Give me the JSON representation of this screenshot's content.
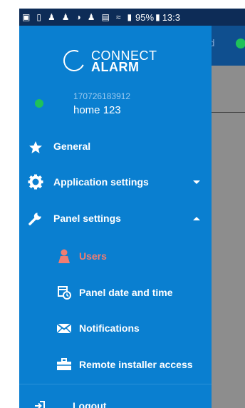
{
  "status_bar": {
    "battery": "95%",
    "time": "13:3"
  },
  "background": {
    "status_text": "cted"
  },
  "drawer": {
    "logo": {
      "line1": "CONNECT",
      "line2": "ALARM"
    },
    "account": {
      "id": "170726183912",
      "name": "home 123"
    },
    "menu": {
      "general": "General",
      "application_settings": "Application settings",
      "panel_settings": "Panel settings",
      "users": "Users",
      "panel_date_time": "Panel date and time",
      "notifications": "Notifications",
      "remote_installer_access": "Remote installer access",
      "logout": "Logout"
    },
    "colors": {
      "drawer_bg": "#0a7fd0",
      "active_item": "#f07d72",
      "online_dot": "#1fc15a",
      "status_bar": "#0d2c57"
    }
  }
}
